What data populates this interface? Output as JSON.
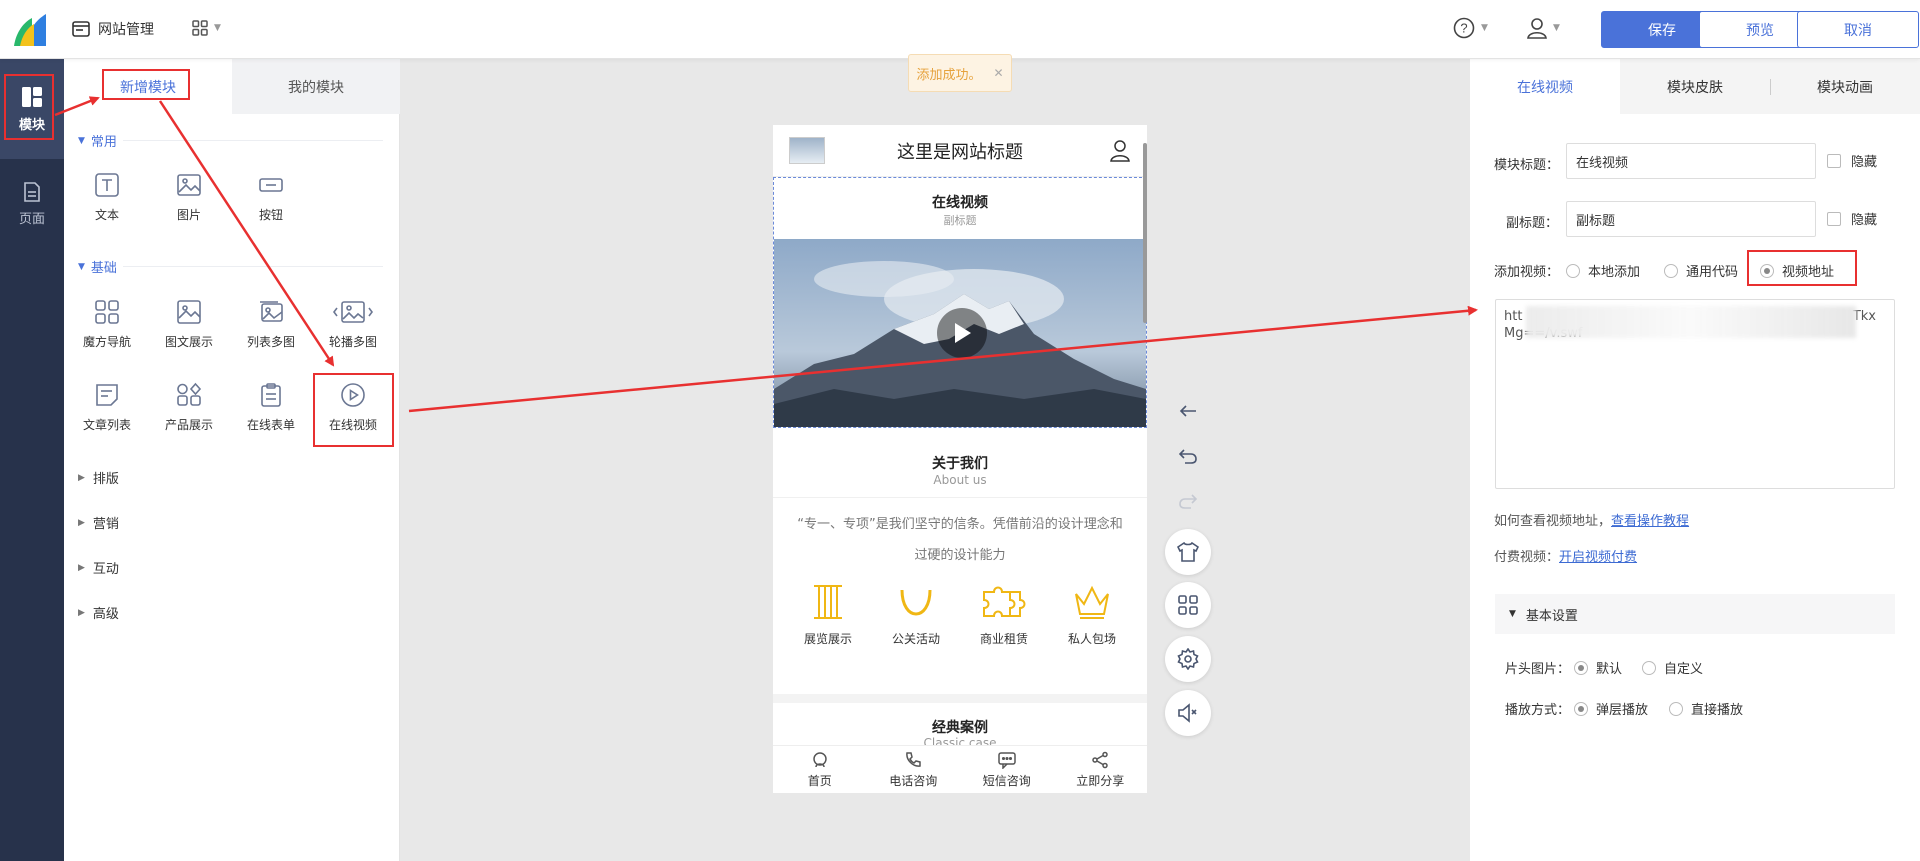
{
  "topbar": {
    "site_manage": "网站管理",
    "save": "保存",
    "preview": "预览",
    "cancel": "取消",
    "help_icon": "question-circle-icon",
    "user_icon": "user-icon"
  },
  "leftnav": {
    "module": "模块",
    "page": "页面"
  },
  "panel": {
    "tab_new": "新增模块",
    "tab_mine": "我的模块",
    "sections": {
      "common": "常用",
      "basic": "基础",
      "layout": "排版",
      "marketing": "营销",
      "interaction": "互动",
      "advanced": "高级"
    },
    "common_items": [
      "文本",
      "图片",
      "按钮"
    ],
    "basic_items": [
      "魔方导航",
      "图文展示",
      "列表多图",
      "轮播多图",
      "文章列表",
      "产品展示",
      "在线表单",
      "在线视频"
    ]
  },
  "toast": {
    "text": "添加成功。",
    "close": "✕"
  },
  "phone": {
    "site_title": "这里是网站标题",
    "video_title": "在线视频",
    "video_sub": "副标题",
    "about_title": "关于我们",
    "about_sub": "About us",
    "about_text": "“专一、专项”是我们坚守的信条。凭借前沿的设计理念和过硬的设计能力",
    "about_items": [
      "展览展示",
      "公关活动",
      "商业租赁",
      "私人包场"
    ],
    "case_title": "经典案例",
    "case_sub": "Classic case",
    "footer": [
      "首页",
      "电话咨询",
      "短信咨询",
      "立即分享"
    ]
  },
  "right": {
    "tabs": [
      "在线视频",
      "模块皮肤",
      "模块动画"
    ],
    "module_title_label": "模块标题：",
    "module_title_value": "在线视频",
    "subtitle_label": "副标题：",
    "subtitle_value": "副标题",
    "hide": "隐藏",
    "add_video_label": "添加视频：",
    "add_video_options": [
      "本地添加",
      "通用代码",
      "视频地址"
    ],
    "url_line1_start": "htt",
    "url_line1_end": "Tkx",
    "url_line2": "Mg==/v.swf",
    "how_to": "如何查看视频地址，",
    "how_to_link": "查看操作教程",
    "paid_label": "付费视频：",
    "paid_link": "开启视频付费",
    "basic_settings": "基本设置",
    "cover_label": "片头图片：",
    "cover_options": [
      "默认",
      "自定义"
    ],
    "play_label": "播放方式：",
    "play_options": [
      "弹层播放",
      "直接播放"
    ]
  },
  "colors": {
    "accent": "#4a72d9",
    "nav_bg": "#27324b",
    "annotation": "#e83030",
    "about_icon": "#f0b714"
  }
}
